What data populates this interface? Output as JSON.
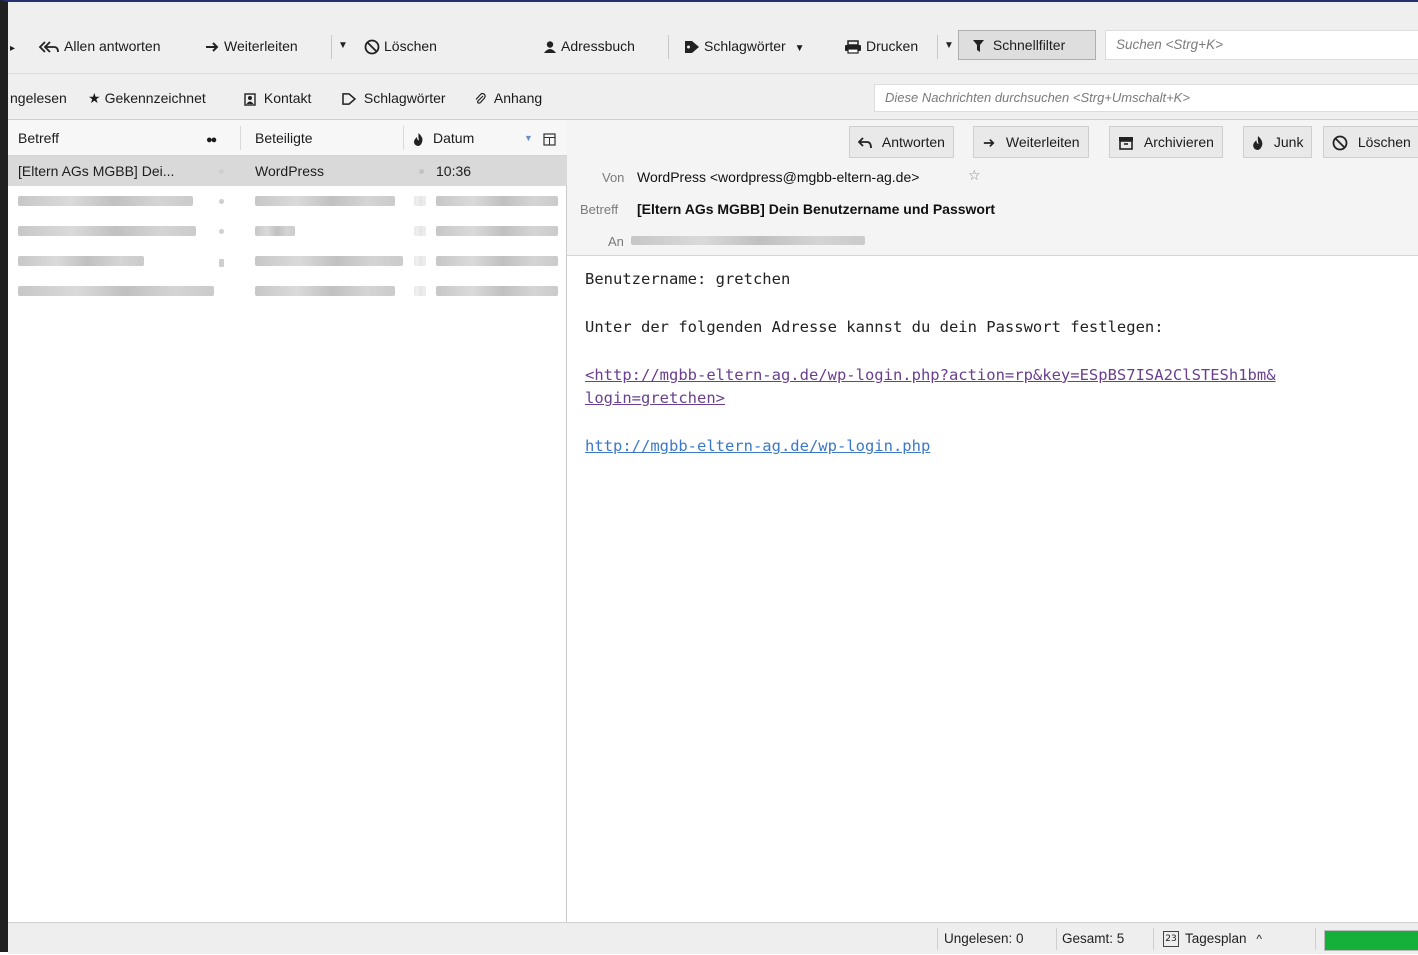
{
  "toolbar": {
    "reply_all": "Allen antworten",
    "forward": "Weiterleiten",
    "delete": "Löschen",
    "address_book": "Adressbuch",
    "tags": "Schlagwörter",
    "print": "Drucken",
    "quick_filter": "Schnellfilter",
    "search_placeholder": "Suchen <Strg+K>"
  },
  "filterbar": {
    "unread": "ngelesen",
    "starred": "Gekennzeichnet",
    "contact": "Kontakt",
    "tags": "Schlagwörter",
    "attachment": "Anhang",
    "search_placeholder": "Diese Nachrichten durchsuchen <Strg+Umschalt+K>"
  },
  "thread_list": {
    "columns": {
      "subject": "Betreff",
      "participants": "Beteiligte",
      "date": "Datum"
    },
    "rows": [
      {
        "subject": "[Eltern AGs MGBB] Dei...",
        "participants": "WordPress",
        "date": "10:36",
        "selected": true
      }
    ],
    "blurred_rows": 4
  },
  "message": {
    "buttons": {
      "reply": "Antworten",
      "forward": "Weiterleiten",
      "archive": "Archivieren",
      "junk": "Junk",
      "delete": "Löschen"
    },
    "from_label": "Von",
    "from_value": "WordPress <wordpress@mgbb-eltern-ag.de>",
    "subject_label": "Betreff",
    "subject_value": "[Eltern AGs MGBB] Dein Benutzername und Passwort",
    "to_label": "An",
    "body": {
      "line1": "Benutzername: gretchen",
      "line2": "Unter der folgenden Adresse kannst du dein Passwort festlegen:",
      "link1_line1": "<http://mgbb-eltern-ag.de/wp-login.php?action=rp&key=ESpBS7ISA2ClSTESh1bm&",
      "link1_line2": "login=gretchen>",
      "link2": "http://mgbb-eltern-ag.de/wp-login.php"
    }
  },
  "statusbar": {
    "unread": "Ungelesen: 0",
    "total": "Gesamt: 5",
    "today_pane": "Tagesplan",
    "today_pane_day": "23",
    "progress": 1.0
  },
  "colors": {
    "window_border": "#26306d",
    "selection": "#d9d9d9",
    "link": "#3b79c8",
    "link_visited": "#6a3f8f",
    "progress": "#15b03a"
  }
}
